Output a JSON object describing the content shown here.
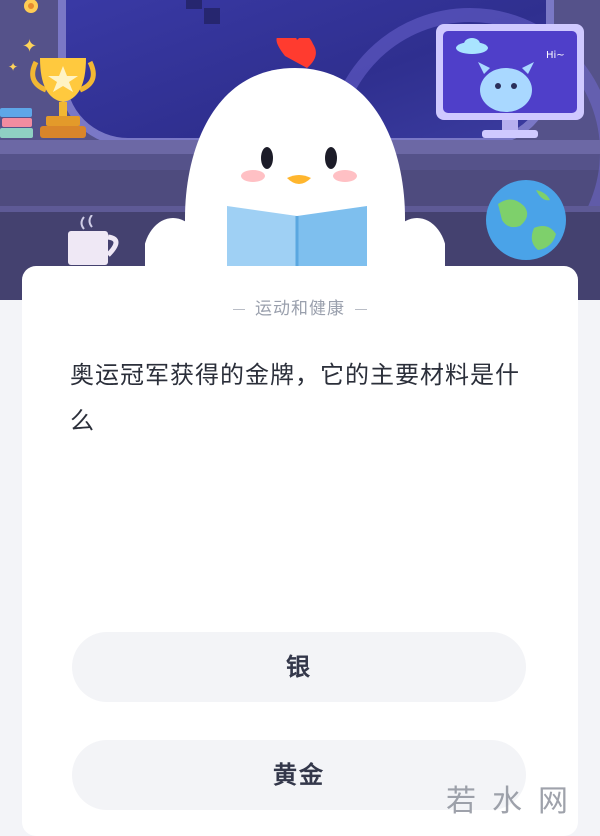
{
  "quiz": {
    "category": "运动和健康",
    "question": "奥运冠军获得的金牌，它的主要材料是什么",
    "options": [
      {
        "label": "银"
      },
      {
        "label": "黄金"
      }
    ]
  },
  "illustration": {
    "monitor_text": "Hi~"
  },
  "watermark": {
    "text": "若水网"
  },
  "colors": {
    "scene_bg": "#4e4b7e",
    "card_bg": "#ffffff",
    "option_bg": "#f3f4f7",
    "question_text": "#2b2f3a",
    "category_text": "#9aa0ad"
  }
}
